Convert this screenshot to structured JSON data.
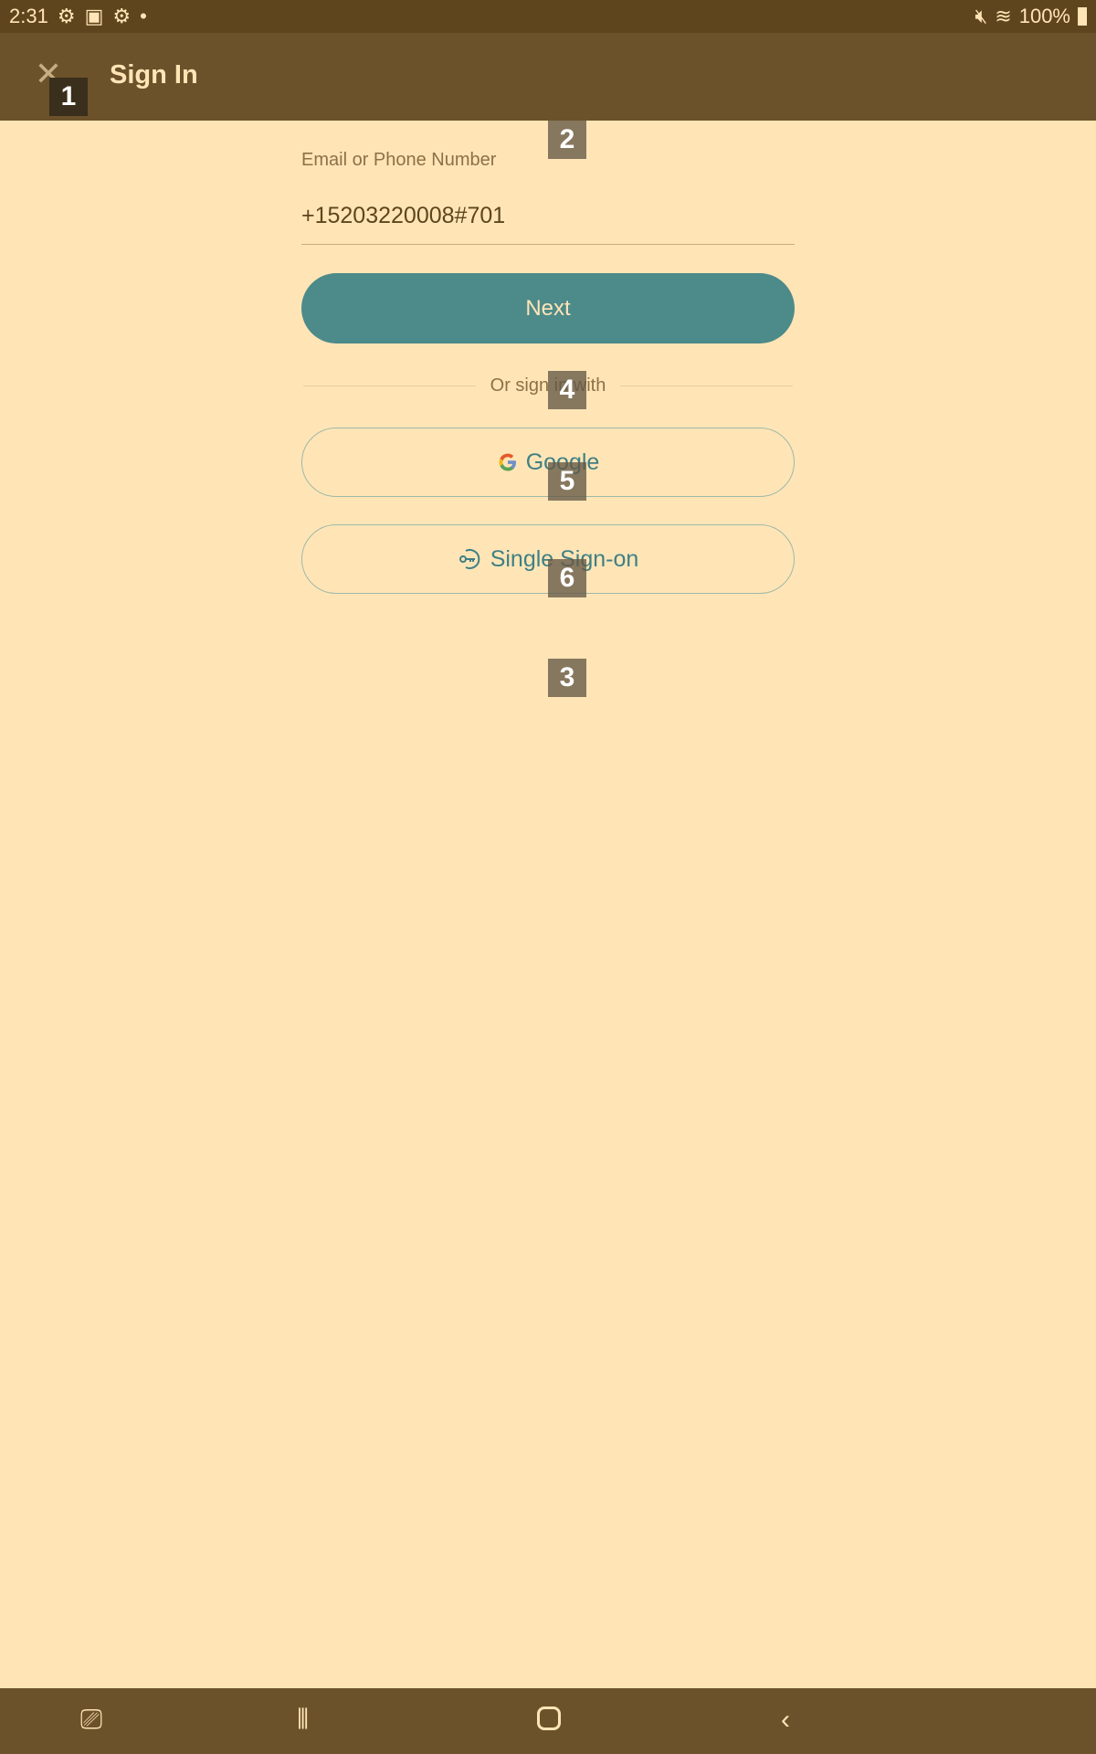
{
  "status_bar": {
    "time": "2:31",
    "battery": "100%"
  },
  "app_bar": {
    "title": "Sign In"
  },
  "form": {
    "label": "Email or Phone Number",
    "value": "+15203220008#701",
    "next_label": "Next"
  },
  "divider_text": "Or sign in with",
  "google_label": "Google",
  "sso_label": "Single Sign-on",
  "badges": [
    "1",
    "2",
    "3",
    "4",
    "5",
    "6"
  ],
  "colors": {
    "primary": "#4d8a8a",
    "appbar": "#6b522a",
    "background": "#ffe5b6"
  }
}
